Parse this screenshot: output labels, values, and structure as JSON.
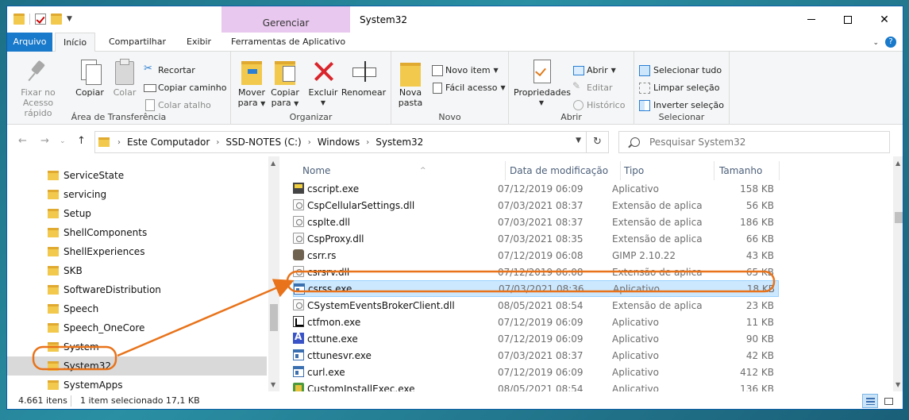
{
  "window": {
    "title": "System32",
    "contextual_header": "Gerenciar"
  },
  "ribbon_tabs": {
    "file": "Arquivo",
    "home": "Início",
    "share": "Compartilhar",
    "view": "Exibir",
    "app_tools": "Ferramentas de Aplicativo"
  },
  "ribbon": {
    "clipboard": {
      "label": "Área de Transferência",
      "pin_line1": "Fixar no",
      "pin_line2": "Acesso rápido",
      "copy": "Copiar",
      "paste": "Colar",
      "cut": "Recortar",
      "copy_path": "Copiar caminho",
      "paste_shortcut": "Colar atalho"
    },
    "organize": {
      "label": "Organizar",
      "move_line1": "Mover",
      "move_line2": "para",
      "copy_line1": "Copiar",
      "copy_line2": "para",
      "delete": "Excluir",
      "rename": "Renomear"
    },
    "new": {
      "label": "Novo",
      "new_folder_line1": "Nova",
      "new_folder_line2": "pasta",
      "new_item": "Novo item",
      "easy_access": "Fácil acesso"
    },
    "open": {
      "label": "Abrir",
      "properties": "Propriedades",
      "open": "Abrir",
      "edit": "Editar",
      "history": "Histórico"
    },
    "select": {
      "label": "Selecionar",
      "select_all": "Selecionar tudo",
      "select_none": "Limpar seleção",
      "invert": "Inverter seleção"
    }
  },
  "address": {
    "crumbs": [
      "Este Computador",
      "SSD-NOTES (C:)",
      "Windows",
      "System32"
    ],
    "search_placeholder": "Pesquisar System32"
  },
  "nav_items": [
    {
      "label": "ServiceState"
    },
    {
      "label": "servicing"
    },
    {
      "label": "Setup"
    },
    {
      "label": "ShellComponents"
    },
    {
      "label": "ShellExperiences"
    },
    {
      "label": "SKB"
    },
    {
      "label": "SoftwareDistribution"
    },
    {
      "label": "Speech"
    },
    {
      "label": "Speech_OneCore"
    },
    {
      "label": "System"
    },
    {
      "label": "System32",
      "selected": true
    },
    {
      "label": "SystemApps"
    }
  ],
  "columns": {
    "name": "Nome",
    "date": "Data de modificação",
    "type": "Tipo",
    "size": "Tamanho"
  },
  "files": [
    {
      "name": "cscript.exe",
      "date": "07/12/2019 06:09",
      "type": "Aplicativo",
      "size": "158 KB",
      "icon": "script"
    },
    {
      "name": "CspCellularSettings.dll",
      "date": "07/03/2021 08:37",
      "type": "Extensão de aplica...",
      "size": "56 KB",
      "icon": "dll"
    },
    {
      "name": "csplte.dll",
      "date": "07/03/2021 08:37",
      "type": "Extensão de aplica...",
      "size": "186 KB",
      "icon": "dll"
    },
    {
      "name": "CspProxy.dll",
      "date": "07/03/2021 08:35",
      "type": "Extensão de aplica...",
      "size": "66 KB",
      "icon": "dll"
    },
    {
      "name": "csrr.rs",
      "date": "07/12/2019 06:08",
      "type": "GIMP 2.10.22",
      "size": "43 KB",
      "icon": "gimp"
    },
    {
      "name": "csrsrv.dll",
      "date": "07/12/2019 06:08",
      "type": "Extensão de aplica...",
      "size": "65 KB",
      "icon": "dll"
    },
    {
      "name": "csrss.exe",
      "date": "07/03/2021 08:36",
      "type": "Aplicativo",
      "size": "18 KB",
      "icon": "exe",
      "selected": true
    },
    {
      "name": "CSystemEventsBrokerClient.dll",
      "date": "08/05/2021 08:54",
      "type": "Extensão de aplica...",
      "size": "23 KB",
      "icon": "dll"
    },
    {
      "name": "ctfmon.exe",
      "date": "07/12/2019 06:09",
      "type": "Aplicativo",
      "size": "11 KB",
      "icon": "ctf"
    },
    {
      "name": "cttune.exe",
      "date": "07/12/2019 06:09",
      "type": "Aplicativo",
      "size": "90 KB",
      "icon": "cttune"
    },
    {
      "name": "cttunesvr.exe",
      "date": "07/03/2021 08:37",
      "type": "Aplicativo",
      "size": "42 KB",
      "icon": "exe"
    },
    {
      "name": "curl.exe",
      "date": "07/12/2019 06:09",
      "type": "Aplicativo",
      "size": "412 KB",
      "icon": "exe"
    },
    {
      "name": "CustomInstallExec.exe",
      "date": "08/05/2021 08:54",
      "type": "Aplicativo",
      "size": "136 KB",
      "icon": "cust"
    }
  ],
  "status": {
    "count": "4.661 itens",
    "selected": "1 item selecionado  17,1 KB"
  },
  "colors": {
    "accent": "#1979ca",
    "annotation": "#e8731a",
    "selection": "#cce8ff"
  }
}
